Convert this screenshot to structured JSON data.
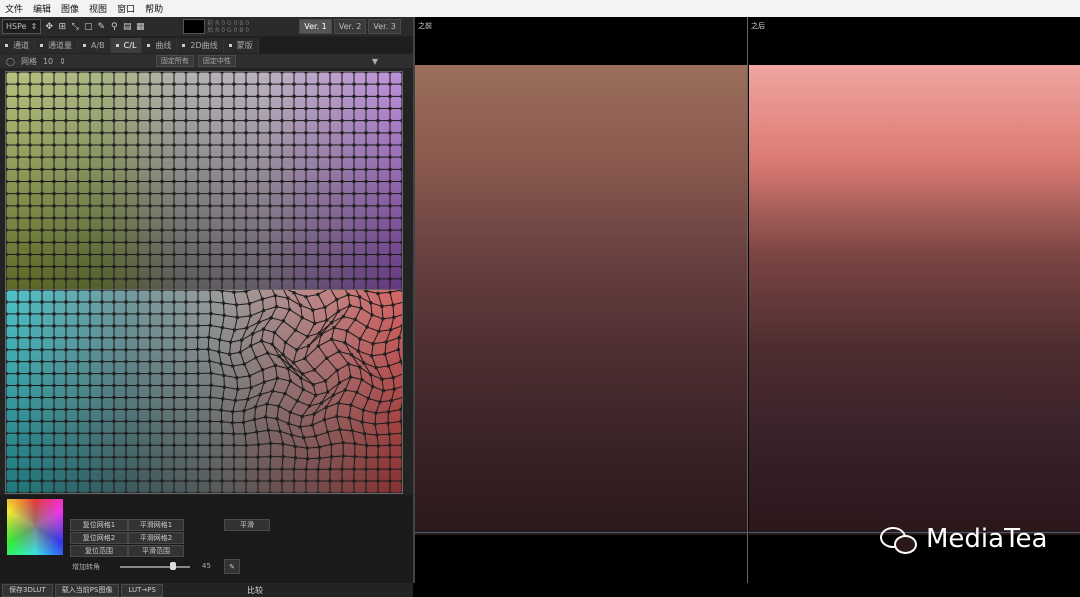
{
  "menubar": [
    "文件",
    "编辑",
    "图像",
    "视图",
    "窗口",
    "帮助"
  ],
  "toolbar": {
    "mode": "HSPe",
    "versions": [
      "Ver. 1",
      "Ver. 2",
      "Ver. 3"
    ],
    "active_version": "Ver. 1"
  },
  "tabs": [
    {
      "label": "通道",
      "active": false
    },
    {
      "label": "通道量",
      "active": false
    },
    {
      "label": "A/B",
      "active": false
    },
    {
      "label": "C/L",
      "active": true
    },
    {
      "label": "曲线",
      "active": false
    },
    {
      "label": "2D曲线",
      "active": false
    },
    {
      "label": "蒙版",
      "active": false
    }
  ],
  "gridbar": {
    "label": "网格",
    "value": "10",
    "buttons": [
      "固定所有",
      "固定中性"
    ]
  },
  "bottom": {
    "buttons_left": [
      "复位网格1",
      "复位网格2",
      "复位范围"
    ],
    "buttons_mid": [
      "平滑网格1",
      "平滑网格2",
      "平滑范围"
    ],
    "button_right": "平滑",
    "slider_label": "增加转角",
    "slider_value": "45"
  },
  "savebar": {
    "buttons": [
      "保存3DLUT",
      "载入当前PS图像",
      "LUT→PS"
    ],
    "compare_label": "比较"
  },
  "viewer": {
    "before_label": "之前",
    "after_label": "之后"
  },
  "watermark": "MediaTea"
}
